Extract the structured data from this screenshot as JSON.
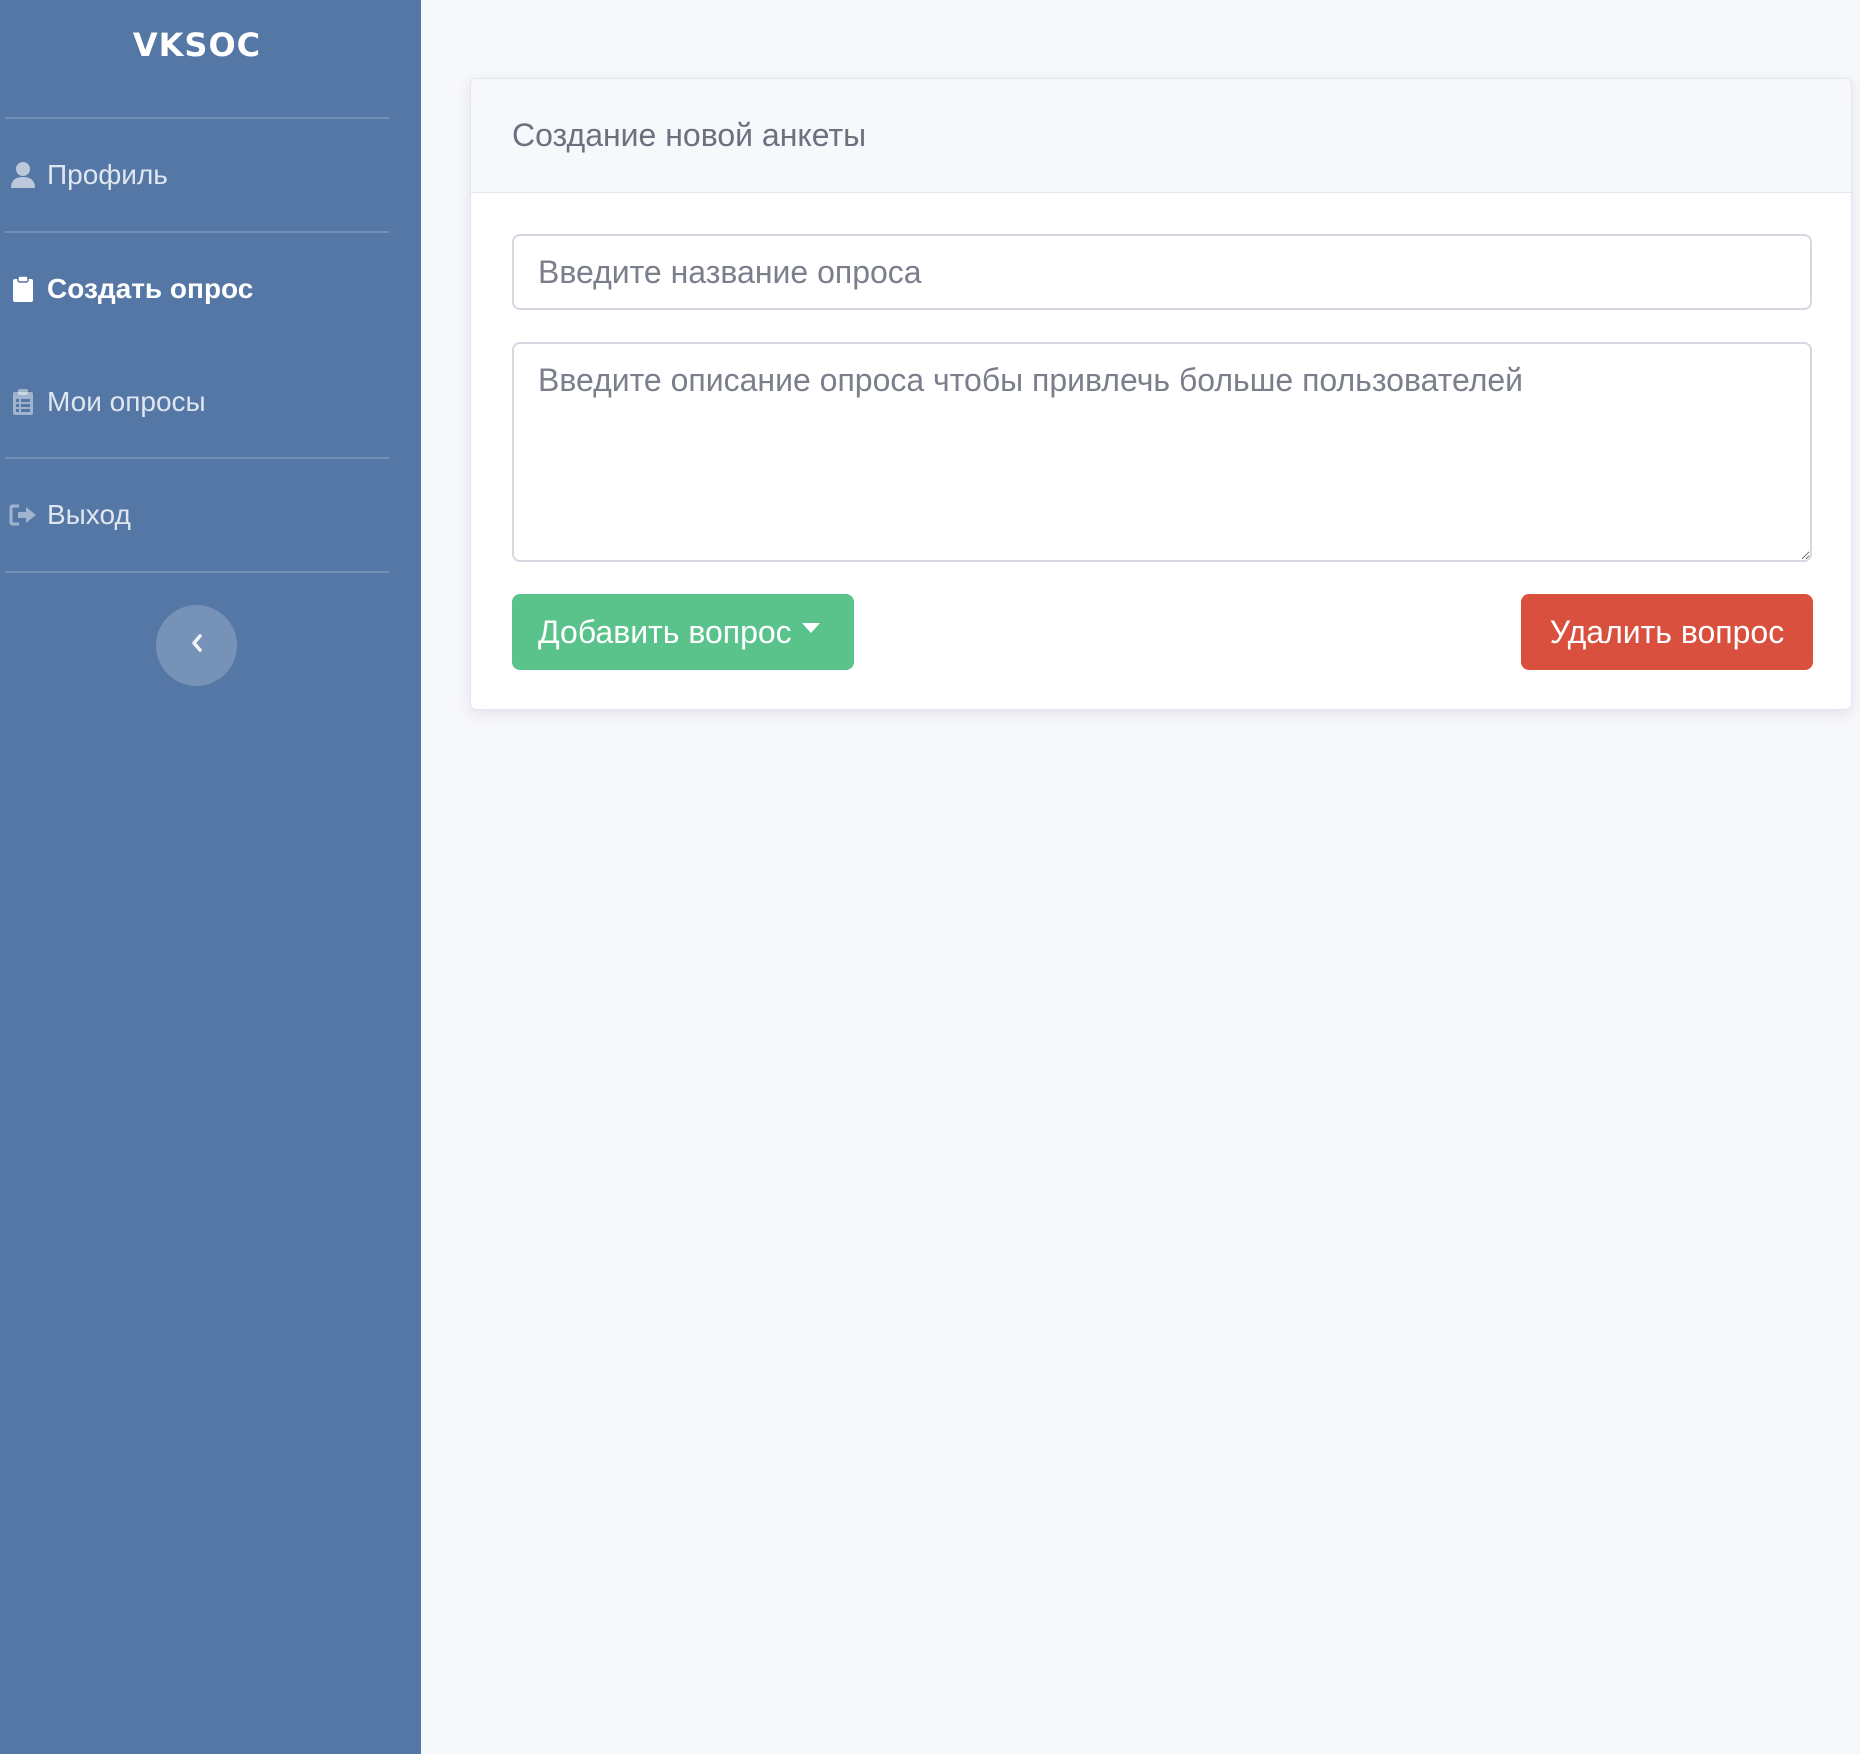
{
  "sidebar": {
    "brand": "VKSOC",
    "items": [
      {
        "label": "Профиль",
        "icon": "user-icon",
        "active": false
      },
      {
        "label": "Создать опрос",
        "icon": "clipboard-icon",
        "active": true
      },
      {
        "label": "Мои опросы",
        "icon": "clipboard-list-icon",
        "active": false
      },
      {
        "label": "Выход",
        "icon": "sign-out-icon",
        "active": false
      }
    ],
    "collapse_icon": "chevron-left-icon"
  },
  "card": {
    "title": "Создание новой анкеты",
    "title_input": {
      "placeholder": "Введите название опроса",
      "value": ""
    },
    "description_input": {
      "placeholder": "Введите описание опроса чтобы привлечь больше пользователей",
      "value": ""
    },
    "add_button": "Добавить вопрос",
    "delete_button": "Удалить вопрос"
  },
  "colors": {
    "sidebar_bg": "#5577a6",
    "page_bg": "#f7f8fc",
    "add_button": "#5ac38c",
    "delete_button": "#d9503f"
  }
}
